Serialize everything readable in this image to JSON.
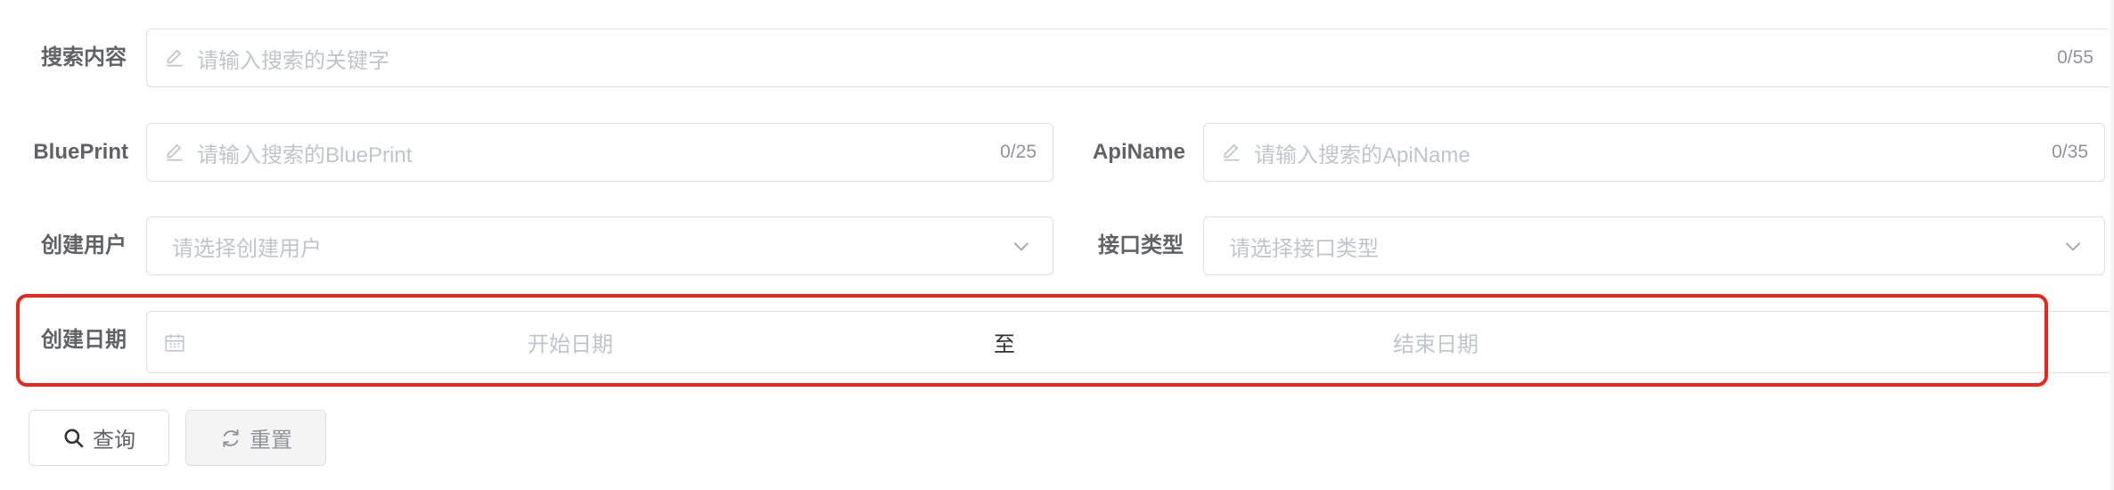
{
  "form": {
    "search": {
      "label": "搜索内容",
      "placeholder": "请输入搜索的关键字",
      "count": "0/55"
    },
    "blueprint": {
      "label": "BluePrint",
      "placeholder": "请输入搜索的BluePrint",
      "count": "0/25"
    },
    "apiname": {
      "label": "ApiName",
      "placeholder": "请输入搜索的ApiName",
      "count": "0/35"
    },
    "creator": {
      "label": "创建用户",
      "placeholder": "请选择创建用户"
    },
    "api_type": {
      "label": "接口类型",
      "placeholder": "请选择接口类型"
    },
    "date": {
      "label": "创建日期",
      "start_placeholder": "开始日期",
      "separator": "至",
      "end_placeholder": "结束日期"
    }
  },
  "buttons": {
    "query": "查询",
    "reset": "重置"
  },
  "icons": {
    "input_prefix": "pencil-icon",
    "select_suffix": "chevron-down-icon",
    "date_prefix": "calendar-icon",
    "query": "search-icon",
    "reset": "refresh-icon"
  },
  "colors": {
    "highlight": "#e8281d",
    "border": "#dcdfe6",
    "placeholder": "#c0c4cc"
  }
}
